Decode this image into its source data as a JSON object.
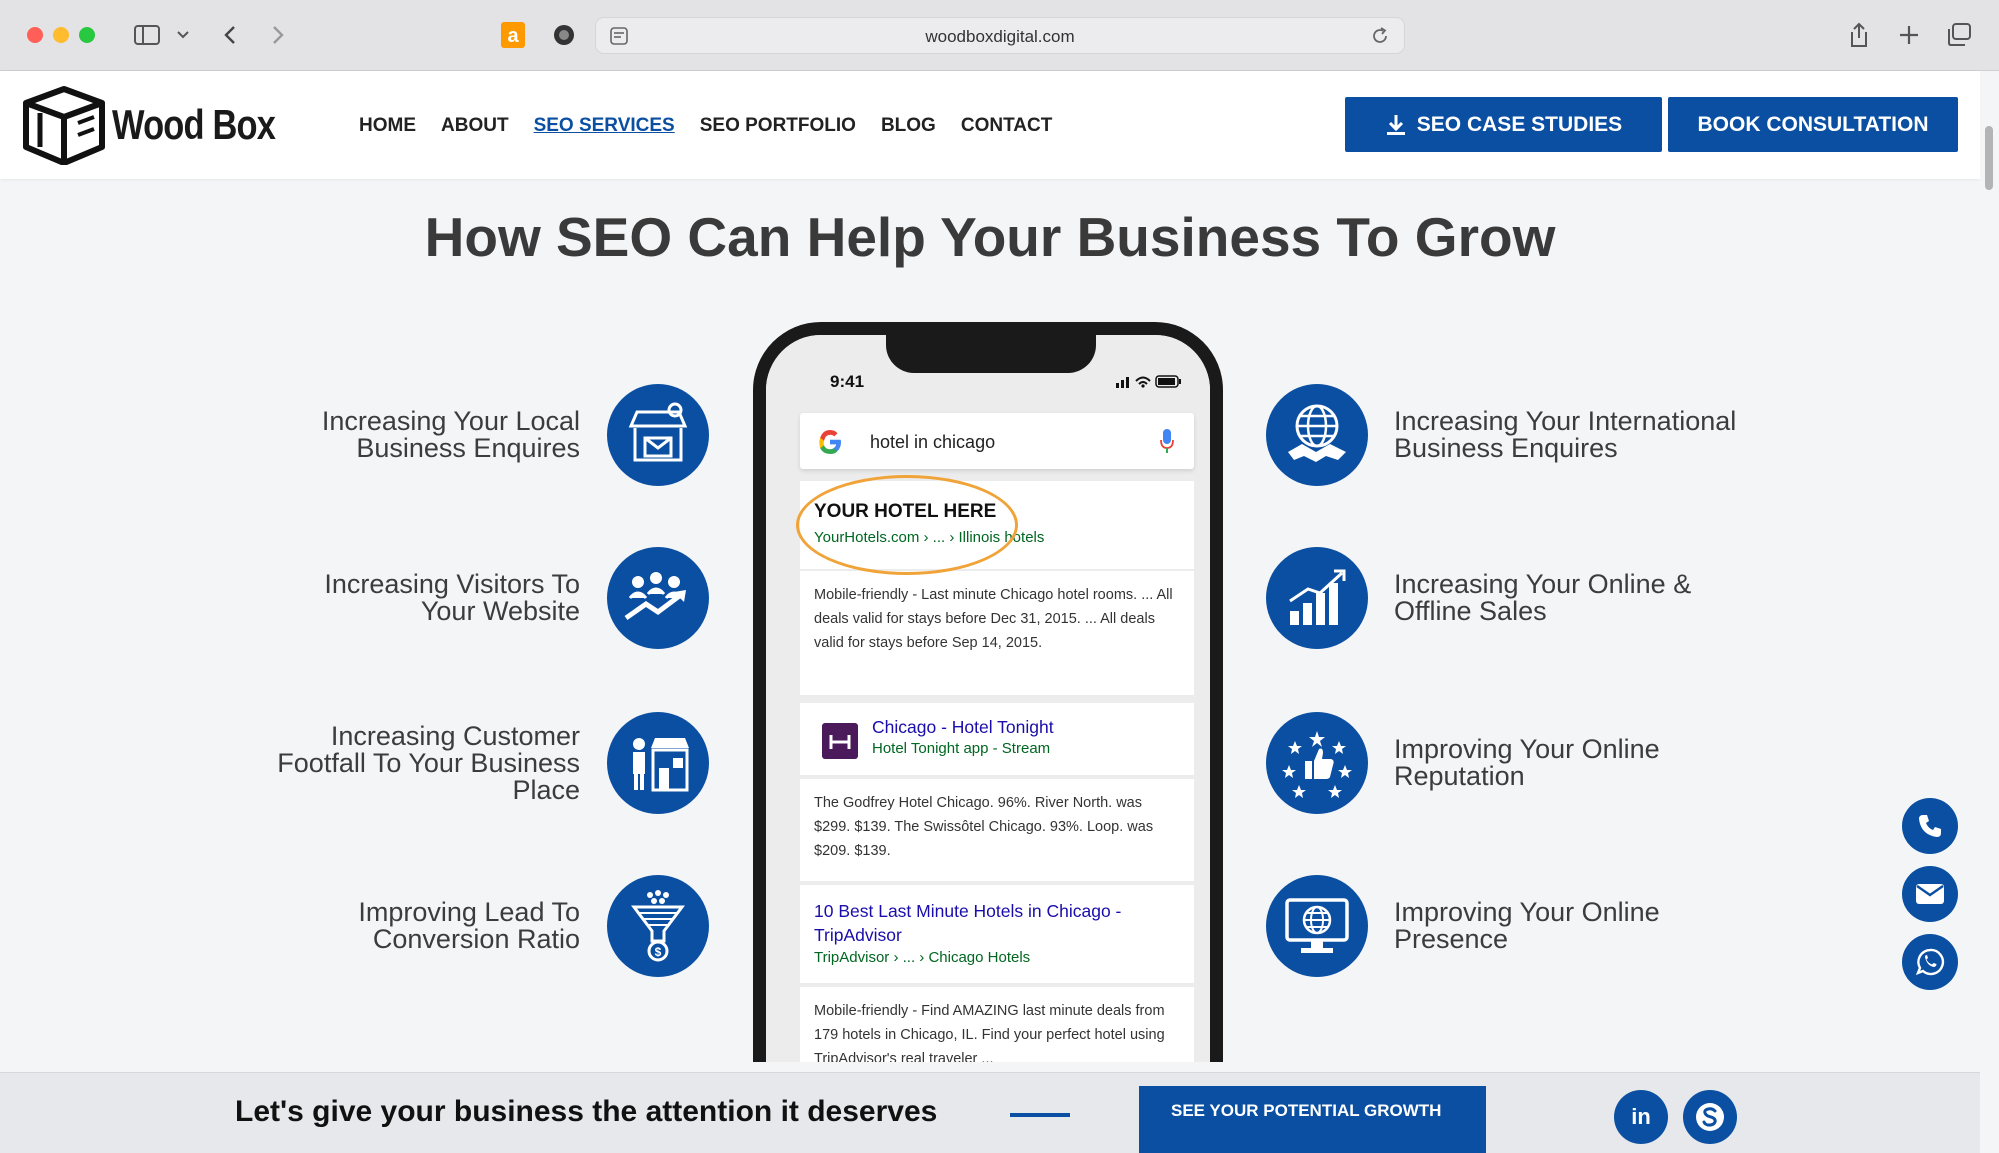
{
  "browser": {
    "url": "woodboxdigital.com"
  },
  "header": {
    "logo_text": "Wood Box",
    "nav": [
      "HOME",
      "ABOUT",
      "SEO SERVICES",
      "SEO PORTFOLIO",
      "BLOG",
      "CONTACT"
    ],
    "active_nav": "SEO SERVICES",
    "case_studies_label": "SEO CASE STUDIES",
    "book_label": "BOOK CONSULTATION"
  },
  "main": {
    "headline": "How SEO Can Help Your Business To Grow",
    "left_features": [
      {
        "label": "Increasing Your Local\nBusiness Enquires",
        "icon": "local-store-icon"
      },
      {
        "label": "Increasing Visitors To\nYour Website",
        "icon": "visitors-growth-icon"
      },
      {
        "label": "Increasing Customer\nFootfall To Your Business\nPlace",
        "icon": "customer-shop-icon"
      },
      {
        "label": "Improving Lead To\nConversion Ratio",
        "icon": "funnel-icon"
      }
    ],
    "right_features": [
      {
        "label": "Increasing Your International\nBusiness Enquires",
        "icon": "globe-handshake-icon"
      },
      {
        "label": "Increasing Your Online &\nOffline Sales",
        "icon": "bar-chart-icon"
      },
      {
        "label": "Improving Your Online\nReputation",
        "icon": "thumbs-up-stars-icon"
      },
      {
        "label": "Improving Your Online\nPresence",
        "icon": "monitor-globe-icon"
      }
    ]
  },
  "phone": {
    "time": "9:41",
    "search_query": "hotel in chicago",
    "result1_title": "YOUR HOTEL HERE",
    "result1_url": "YourHotels.com › ... › Illinois hotels",
    "result1_snippet": "Mobile-friendly - Last minute Chicago hotel rooms. ... All deals valid for stays before Dec 31, 2015. ... All deals valid for stays before Sep 14, 2015.",
    "result2_title": "Chicago - Hotel Tonight",
    "result2_sub": "Hotel Tonight app - Stream",
    "result2_snippet": "The Godfrey Hotel Chicago. 96%. River North. was $299. $139. The Swissôtel Chicago. 93%. Loop. was $209. $139.",
    "result3_title": "10 Best Last Minute Hotels in Chicago - TripAdvisor",
    "result3_url": "TripAdvisor › ... › Chicago Hotels",
    "result3_snippet": "Mobile-friendly - Find AMAZING last minute deals from 179 hotels in Chicago, IL. Find your perfect hotel using TripAdvisor's real traveler ..."
  },
  "bottom": {
    "cta_text": "Let's give your business the attention it deserves",
    "cta_button": "SEE YOUR POTENTIAL GROWTH",
    "linkedin": "in"
  },
  "colors": {
    "brand_blue": "#0a4fa2",
    "highlight_orange": "#f0a338"
  }
}
